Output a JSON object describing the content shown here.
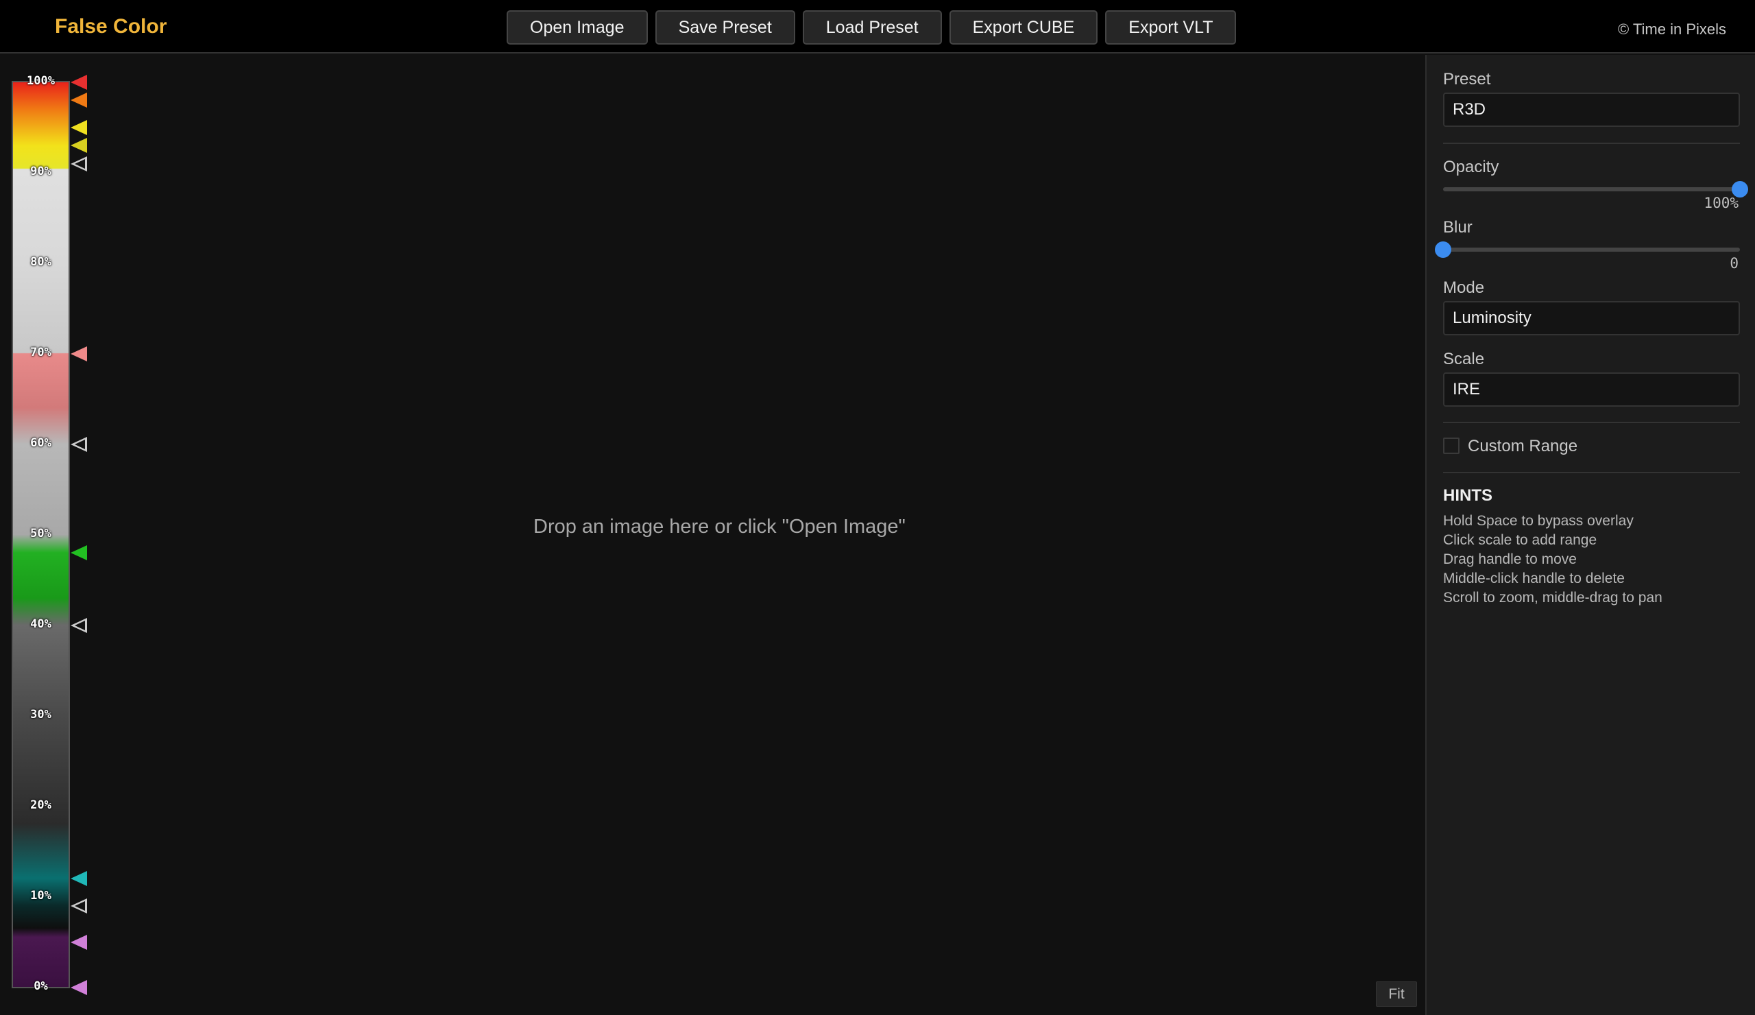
{
  "app": {
    "title": "False Color",
    "copyright": "© Time in Pixels"
  },
  "toolbar": {
    "buttons": [
      "Open Image",
      "Save Preset",
      "Load Preset",
      "Export CUBE",
      "Export VLT"
    ]
  },
  "canvas": {
    "drop_hint": "Drop an image here or click \"Open Image\"",
    "fit_label": "Fit"
  },
  "scale": {
    "labels": [
      "100%",
      "90%",
      "80%",
      "70%",
      "60%",
      "50%",
      "40%",
      "30%",
      "20%",
      "10%",
      "0%"
    ],
    "handles": [
      {
        "color": "#e83030"
      },
      {
        "color": "#f07a14"
      },
      {
        "color": "#f0e020"
      },
      {
        "color": "#d8d020"
      },
      {
        "color": "#cccccc"
      },
      {
        "color": "#f08a8a"
      },
      {
        "color": "#cccccc"
      },
      {
        "color": "#22c022"
      },
      {
        "color": "#cccccc"
      },
      {
        "color": "#20b8b8"
      },
      {
        "color": "#cccccc"
      },
      {
        "color": "#d080d8"
      },
      {
        "color": "#d080d8"
      }
    ]
  },
  "panel": {
    "preset_label": "Preset",
    "preset_value": "R3D",
    "opacity_label": "Opacity",
    "opacity_value": "100%",
    "opacity_level": 1.0,
    "blur_label": "Blur",
    "blur_value": "0",
    "blur_level": 0.0,
    "mode_label": "Mode",
    "mode_value": "Luminosity",
    "scale_label": "Scale",
    "scale_value": "IRE",
    "custom_range_label": "Custom Range",
    "hints_title": "HINTS",
    "hints": [
      "Hold Space to bypass overlay",
      "Click scale to add range",
      "Drag handle to move",
      "Middle-click handle to delete",
      "Scroll to zoom, middle-drag to pan"
    ]
  },
  "colors": {
    "accent": "#3b8cf0",
    "brand": "#f0b53a"
  }
}
